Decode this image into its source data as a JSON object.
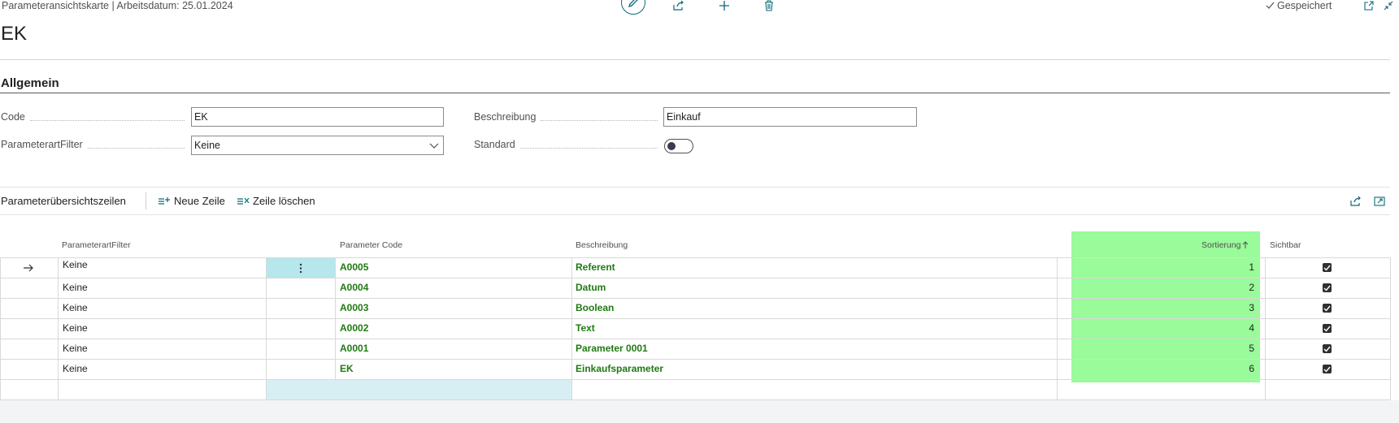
{
  "header": {
    "breadcrumb": "Parameteransichtskarte | Arbeitsdatum: 25.01.2024",
    "title": "EK",
    "saved_label": "Gespeichert",
    "icons": [
      "edit-icon",
      "share-icon",
      "new-icon",
      "delete-icon",
      "open-new-window-icon",
      "collapse-icon"
    ]
  },
  "general": {
    "section_title": "Allgemein",
    "code_label": "Code",
    "code_value": "EK",
    "filter_label": "ParameterartFilter",
    "filter_value": "Keine",
    "description_label": "Beschreibung",
    "description_value": "Einkauf",
    "standard_label": "Standard",
    "standard_on": false
  },
  "lines": {
    "title": "Parameterübersichtszeilen",
    "new_row_label": "Neue Zeile",
    "delete_row_label": "Zeile löschen",
    "columns": {
      "filter": "ParameterartFilter",
      "code": "Parameter Code",
      "description": "Beschreibung",
      "sort": "Sortierung",
      "visible": "Sichtbar"
    },
    "rows": [
      {
        "filter": "Keine",
        "code": "A0005",
        "description": "Referent",
        "sort": "1",
        "visible": true
      },
      {
        "filter": "Keine",
        "code": "A0004",
        "description": "Datum",
        "sort": "2",
        "visible": true
      },
      {
        "filter": "Keine",
        "code": "A0003",
        "description": "Boolean",
        "sort": "3",
        "visible": true
      },
      {
        "filter": "Keine",
        "code": "A0002",
        "description": "Text",
        "sort": "4",
        "visible": true
      },
      {
        "filter": "Keine",
        "code": "A0001",
        "description": "Parameter 0001",
        "sort": "5",
        "visible": true
      },
      {
        "filter": "Keine",
        "code": "EK",
        "description": "Einkaufsparameter",
        "sort": "6",
        "visible": true
      }
    ]
  },
  "colors": {
    "accent": "#0a6b7a",
    "highlight": "#99fb99",
    "link_green": "#1f7a12"
  }
}
